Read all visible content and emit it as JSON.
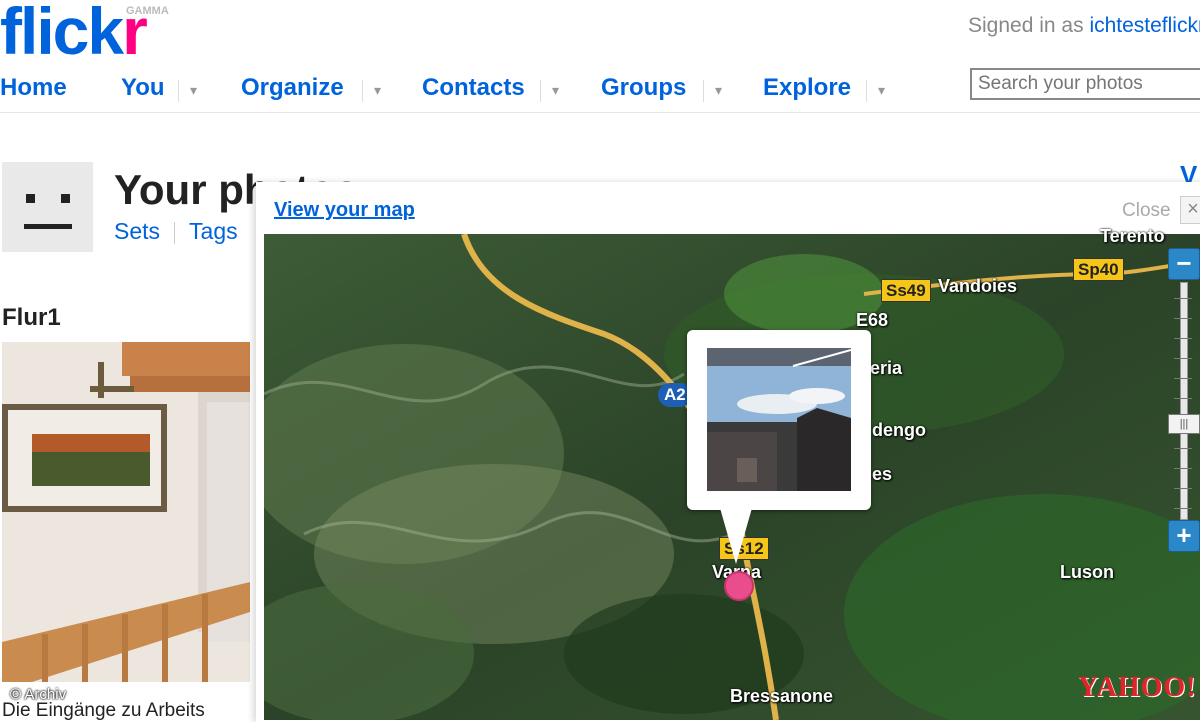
{
  "header": {
    "logo_flick": "flick",
    "logo_r": "r",
    "logo_tag": "GAMMA",
    "signed_in_prefix": "Signed in as",
    "signed_in_user": "ichtesteflickr"
  },
  "nav": {
    "home": "Home",
    "you": "You",
    "organize": "Organize",
    "contacts": "Contacts",
    "groups": "Groups",
    "explore": "Explore"
  },
  "search": {
    "placeholder": "Search your photos"
  },
  "page": {
    "title": "Your photos",
    "sets": "Sets",
    "tags": "Tags",
    "right_link": "V"
  },
  "photo": {
    "title": "Flur1",
    "caption": "Die Eingänge zu Arbeits",
    "credit": "© Archiv"
  },
  "map": {
    "view_link": "View your map",
    "close_label": "Close",
    "close_icon": "×",
    "places": {
      "vandoies": "Vandoies",
      "varna": "Varna",
      "luson": "Luson",
      "bressanone": "Bressanone",
      "eria": "eria",
      "dengo": "dengo",
      "es": "es",
      "trento_top": "Terento"
    },
    "roads": {
      "ss49": "Ss49",
      "sp40": "Sp40",
      "e68": "E68",
      "a22": "A2",
      "ss12": "Ss12"
    },
    "zoom_in": "+",
    "zoom_out": "−",
    "provider": "YAHOO!",
    "colors": {
      "pin": "#e94d8b",
      "zoom": "#2a88c9",
      "road": "#e0b24a"
    }
  }
}
